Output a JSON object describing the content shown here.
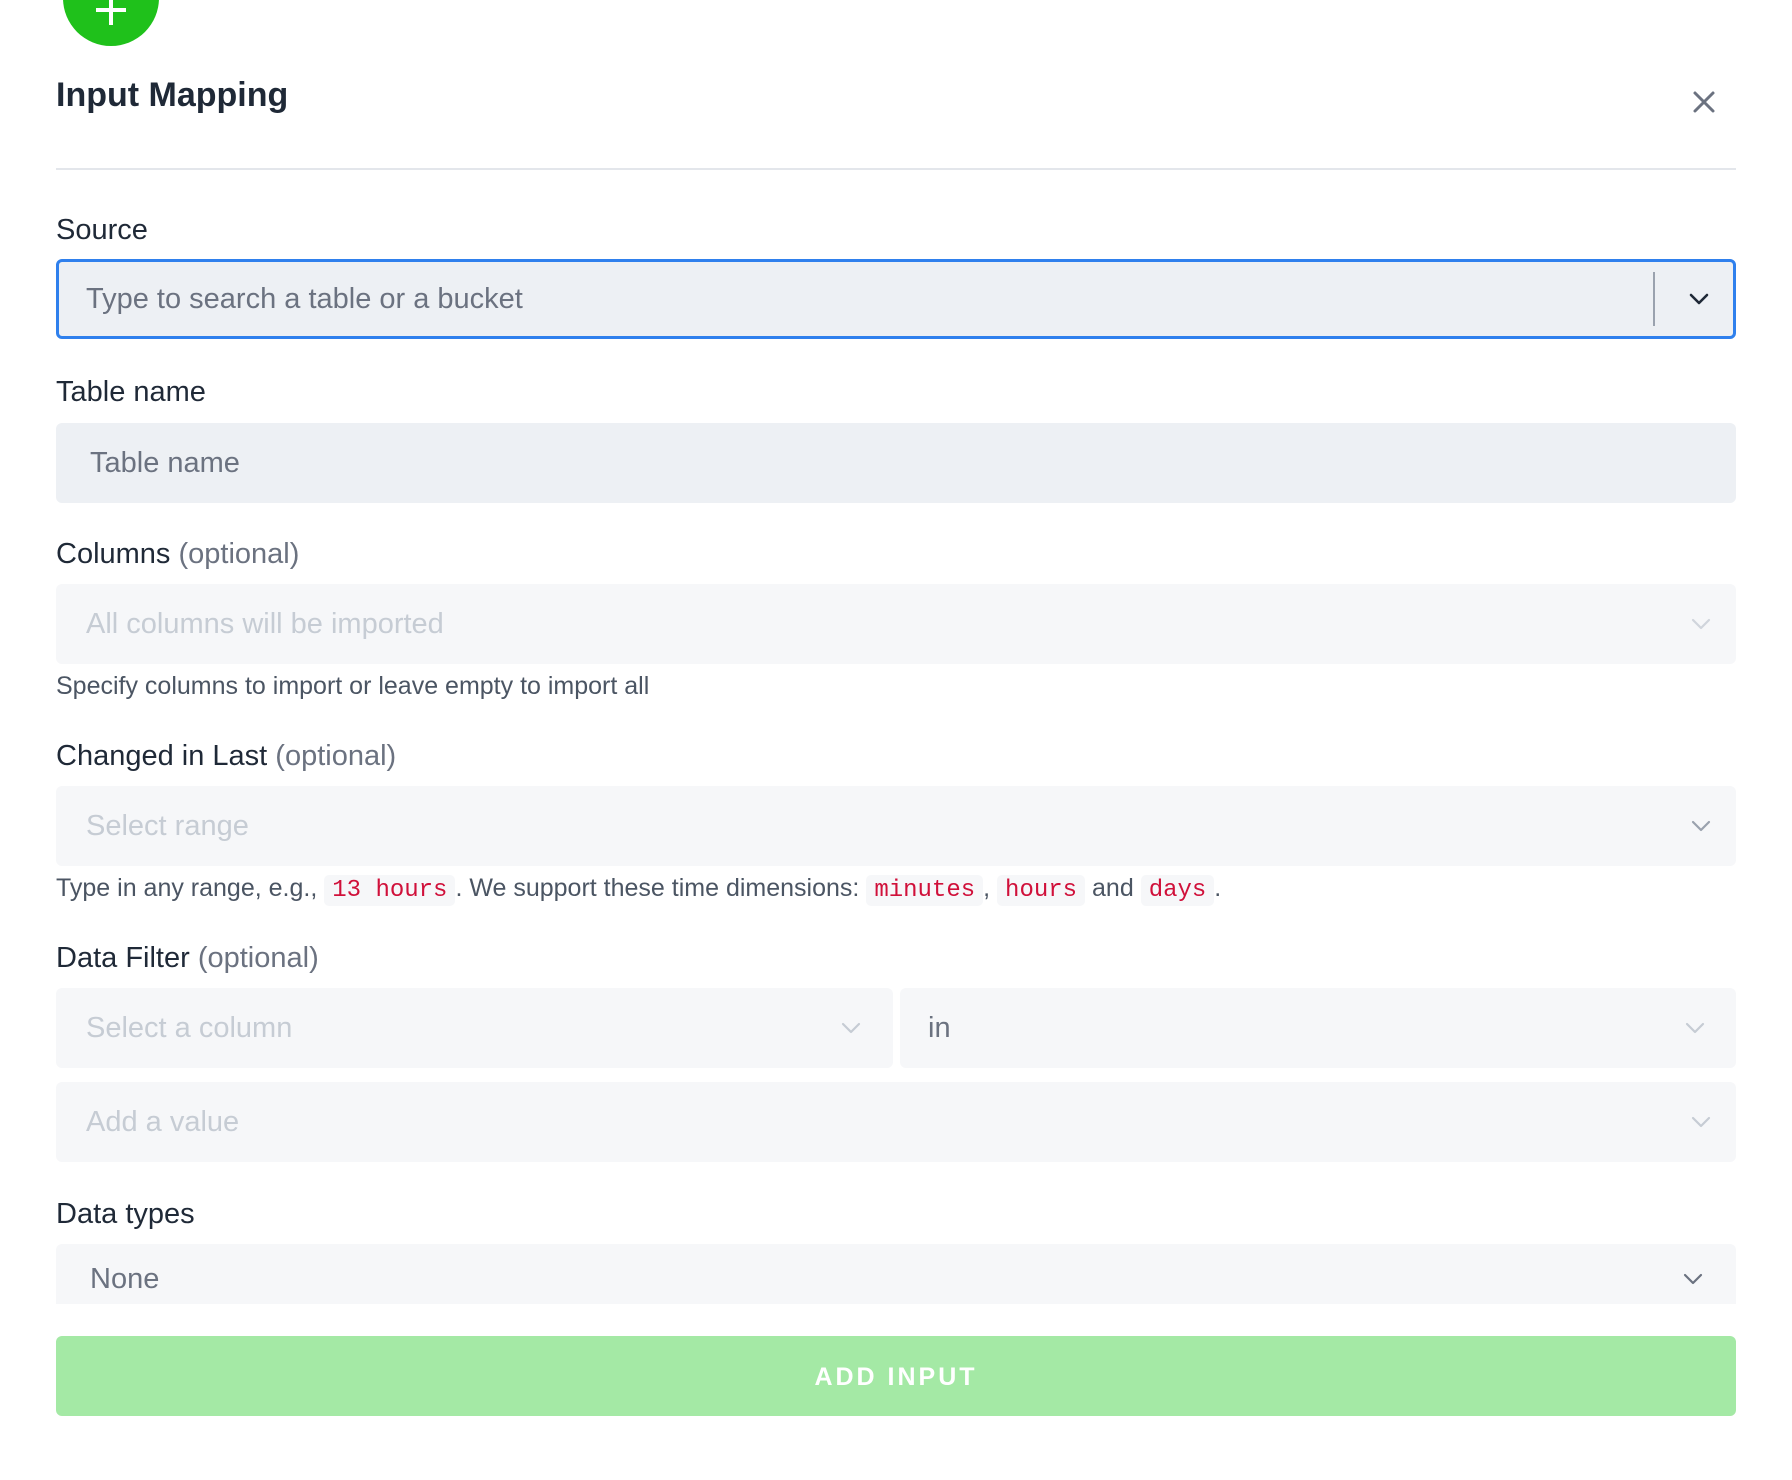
{
  "header": {
    "title": "Input Mapping",
    "add_icon": "plus-icon",
    "close_icon": "close-icon"
  },
  "source": {
    "label": "Source",
    "placeholder": "Type to search a table or a bucket"
  },
  "table_name": {
    "label": "Table name",
    "placeholder": "Table name"
  },
  "columns": {
    "label": "Columns",
    "optional": "(optional)",
    "placeholder": "All columns will be imported",
    "help": "Specify columns to import or leave empty to import all"
  },
  "changed_in_last": {
    "label": "Changed in Last",
    "optional": "(optional)",
    "placeholder": "Select range",
    "help_prefix": "Type in any range, e.g.,",
    "help_example": "13 hours",
    "help_mid": ". We support these time dimensions:",
    "dim_1": "minutes",
    "comma": ",",
    "dim_2": "hours",
    "and": "and",
    "dim_3": "days",
    "period": "."
  },
  "data_filter": {
    "label": "Data Filter",
    "optional": "(optional)",
    "column_placeholder": "Select a column",
    "operator_value": "in",
    "value_placeholder": "Add a value"
  },
  "data_types": {
    "label": "Data types",
    "value": "None"
  },
  "submit": {
    "label": "ADD INPUT"
  },
  "colors": {
    "accent_green": "#1fc11b",
    "button_disabled": "#a4e9a5",
    "focus_border": "#2f80ed",
    "code_red": "#d0103a"
  }
}
